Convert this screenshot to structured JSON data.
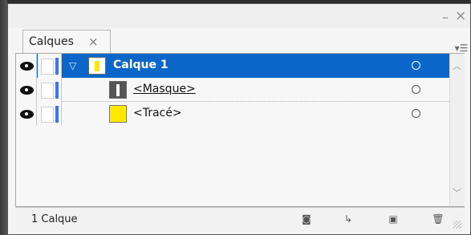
{
  "window": {
    "min_glyph": "–",
    "close_glyph": "×"
  },
  "tab": {
    "label": "Calques",
    "close_glyph": "×"
  },
  "panel_menu_glyph": "▾☰",
  "layers": [
    {
      "name": "Calque 1",
      "selected": true,
      "thumb": "calque",
      "target_glyph": ""
    },
    {
      "name": "<Masque>",
      "selected": false,
      "thumb": "mask",
      "target_glyph": ""
    },
    {
      "name": "<Tracé>",
      "selected": false,
      "thumb": "trace",
      "target_glyph": ""
    }
  ],
  "footer": {
    "count": "1 Calque",
    "buttons": [
      {
        "name": "make-clipping-mask-button",
        "glyph": "◙"
      },
      {
        "name": "create-sublayer-button",
        "glyph": "↳"
      },
      {
        "name": "new-layer-button",
        "glyph": "▣"
      },
      {
        "name": "delete-button",
        "glyph": "🗑"
      }
    ]
  },
  "colors": {
    "selection": "#0a66c8",
    "layer_color": "#3b74ff",
    "thumb_yellow": "#ffe900"
  }
}
